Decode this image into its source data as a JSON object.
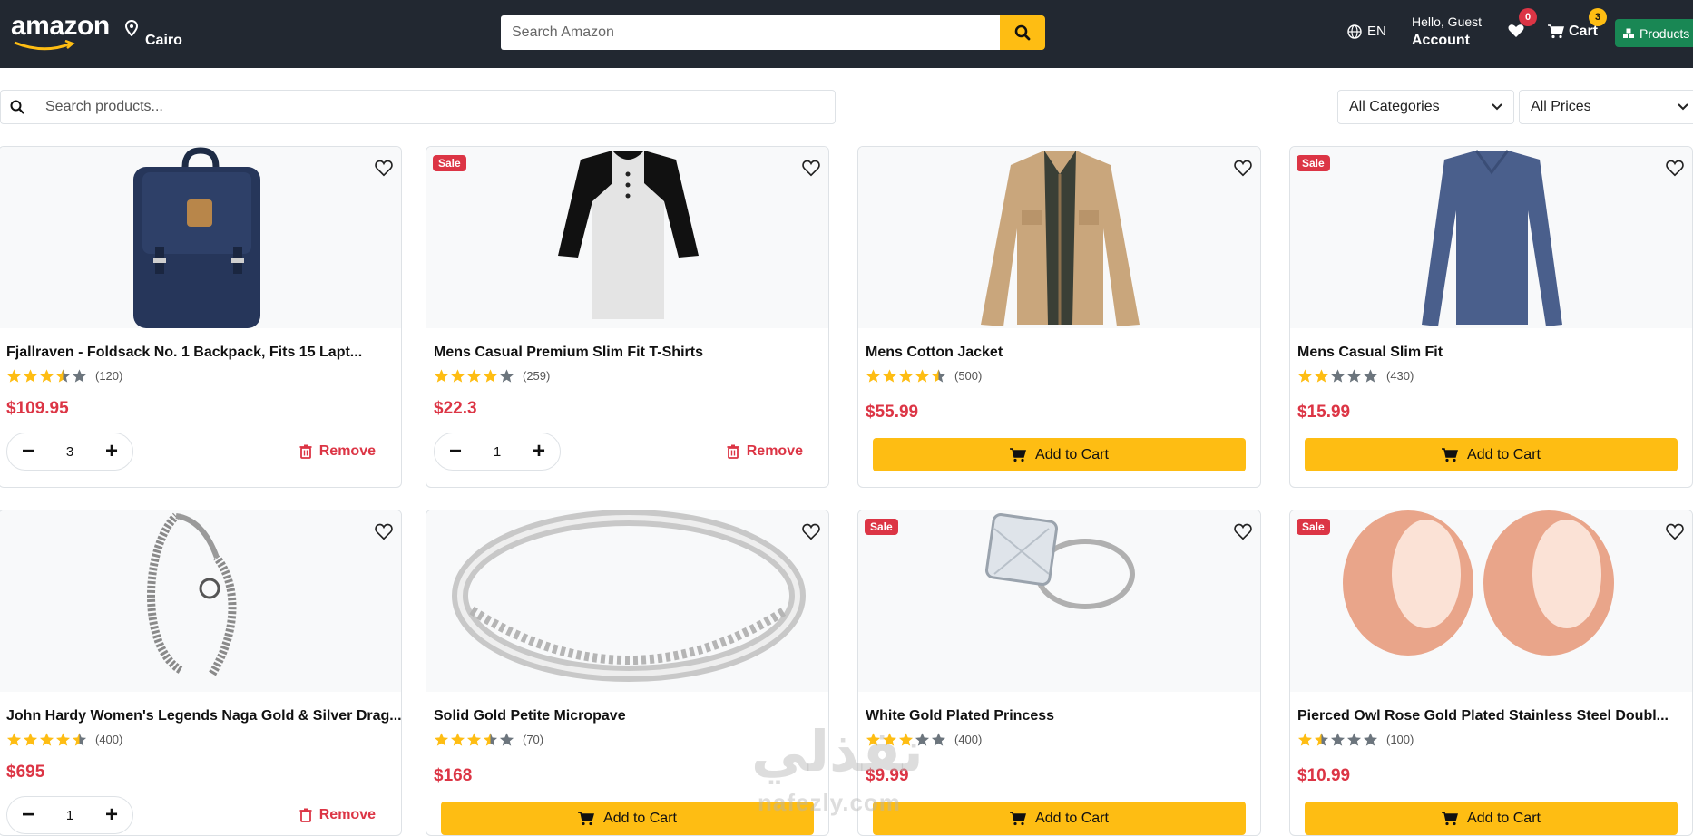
{
  "header": {
    "logo": "amazon",
    "location": "Cairo",
    "search_placeholder": "Search Amazon",
    "language": "EN",
    "greeting": "Hello, Guest",
    "account_label": "Account",
    "wishlist_count": "0",
    "cart_label": "Cart",
    "cart_count": "3",
    "products_label": "Products"
  },
  "filters": {
    "search_placeholder": "Search products...",
    "category": "All Categories",
    "price": "All Prices"
  },
  "products": [
    {
      "title": "Fjallraven - Foldsack No. 1 Backpack, Fits 15 Lapt...",
      "rating": 3.5,
      "count": "(120)",
      "price": "$109.95",
      "sale": "",
      "qty": "3",
      "remove": "Remove"
    },
    {
      "title": "Mens Casual Premium Slim Fit T-Shirts",
      "rating": 4,
      "count": "(259)",
      "price": "$22.3",
      "sale": "Sale",
      "qty": "1",
      "remove": "Remove"
    },
    {
      "title": "Mens Cotton Jacket",
      "rating": 4.5,
      "count": "(500)",
      "price": "$55.99",
      "sale": "",
      "add": "Add to Cart"
    },
    {
      "title": "Mens Casual Slim Fit",
      "rating": 2,
      "count": "(430)",
      "price": "$15.99",
      "sale": "Sale",
      "add": "Add to Cart"
    },
    {
      "title": "John Hardy Women's Legends Naga Gold & Silver Drag...",
      "rating": 4.5,
      "count": "(400)",
      "price": "$695",
      "sale": "",
      "qty": "1",
      "remove": "Remove"
    },
    {
      "title": "Solid Gold Petite Micropave",
      "rating": 3.5,
      "count": "(70)",
      "price": "$168",
      "sale": "",
      "add": "Add to Cart"
    },
    {
      "title": "White Gold Plated Princess",
      "rating": 3,
      "count": "(400)",
      "price": "$9.99",
      "sale": "Sale",
      "add": "Add to Cart"
    },
    {
      "title": "Pierced Owl Rose Gold Plated Stainless Steel Doubl...",
      "rating": 1.5,
      "count": "(100)",
      "price": "$10.99",
      "sale": "Sale",
      "add": "Add to Cart"
    }
  ],
  "watermark": {
    "arabic": "نفذلي",
    "latin": "nafezly.com"
  },
  "colors": {
    "header_bg": "#222831",
    "accent": "#febd13",
    "danger": "#dc3545",
    "success": "#198754"
  }
}
